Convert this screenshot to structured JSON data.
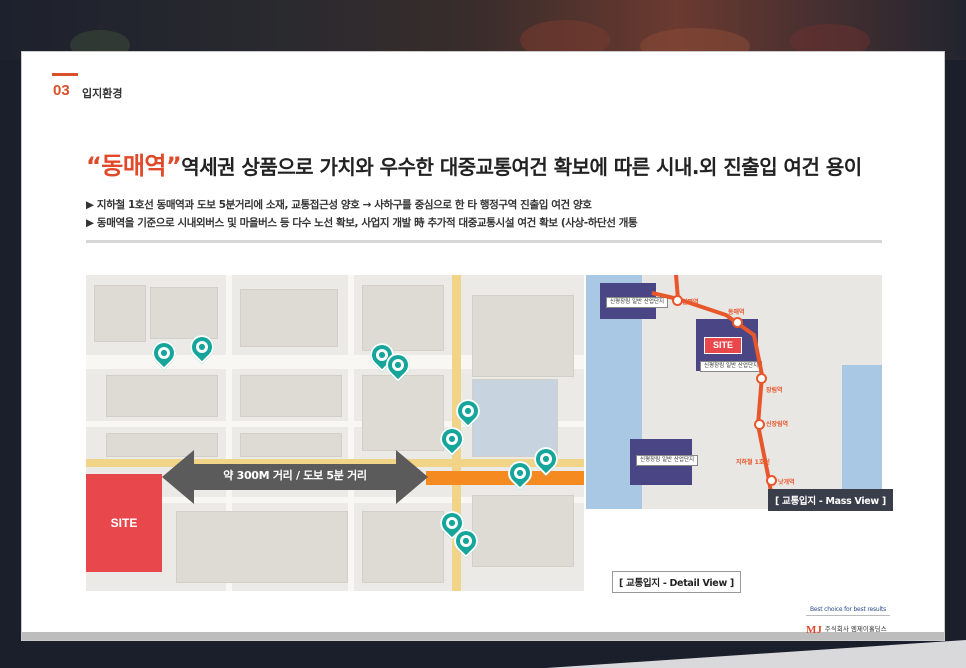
{
  "section": {
    "number": "03",
    "title": "입지환경"
  },
  "headline": {
    "highlight": "“동매역”",
    "text": "역세권 상품으로 가치와 우수한 대중교통여건 확보에 따른 시내.외 진출입 여건 용이"
  },
  "bullets": [
    "▶ 지하철 1호선 동매역과 도보 5분거리에 소재, 교통접근성 양호 → 사하구를 중심으로 한 타 행정구역 진출입 여건 양호",
    "▶ 동매역을 기준으로 시내외버스 및 마을버스 등 다수 노선 확보, 사업지 개발 時 추가적 대중교통시설 여건 확보 (사상-하단선 개통"
  ],
  "detail_map": {
    "site_label": "SITE",
    "distance_label": "약 300M 거리 / 도보 5분 거리",
    "caption": "[ 교통입지 - Detail View ]"
  },
  "mass_map": {
    "site_label": "SITE",
    "caption": "[ 교통입지 - Mass View ]",
    "labels": [
      "신평장림 일반 산업단지",
      "신평장림 일반 산업단지",
      "신평장림 일반 산업단지"
    ],
    "stations": [
      "신평역",
      "동매역",
      "장림역",
      "신장림역",
      "낫개역"
    ],
    "line_label": "지하철 1호선",
    "colors": {
      "line": "#e8562b",
      "zone": "#4a4584",
      "sea": "#a9c8e3"
    }
  },
  "footer": {
    "tagline": "Best choice for best results",
    "brand": "MJ",
    "company": "주식회사 엠제이홀딩스"
  },
  "colors": {
    "accent": "#e04a2b",
    "site": "#e8474b",
    "pin": "#16a59a",
    "subway": "#f58a21"
  }
}
